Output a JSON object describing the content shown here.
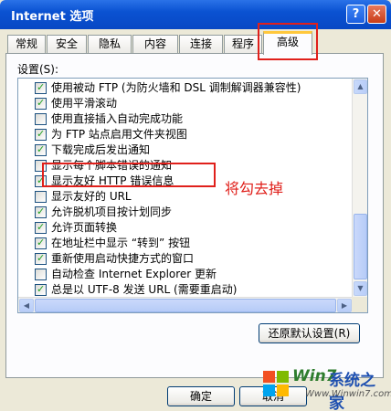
{
  "window": {
    "title": "Internet 选项"
  },
  "titlebar": {
    "help_glyph": "?",
    "close_glyph": "✕"
  },
  "tabs": [
    {
      "label": "常规"
    },
    {
      "label": "安全"
    },
    {
      "label": "隐私"
    },
    {
      "label": "内容"
    },
    {
      "label": "连接"
    },
    {
      "label": "程序"
    },
    {
      "label": "高级",
      "active": true
    }
  ],
  "settings": {
    "label": "设置(S):",
    "items": [
      {
        "label": "使用被动 FTP (为防火墙和 DSL 调制解调器兼容性)",
        "checked": true
      },
      {
        "label": "使用平滑滚动",
        "checked": true
      },
      {
        "label": "使用直接插入自动完成功能",
        "checked": false
      },
      {
        "label": "为 FTP 站点启用文件夹视图",
        "checked": true
      },
      {
        "label": "下载完成后发出通知",
        "checked": true
      },
      {
        "label": "显示每个脚本错误的通知",
        "checked": false
      },
      {
        "label": "显示友好 HTTP 错误信息",
        "checked": true
      },
      {
        "label": "显示友好的 URL",
        "checked": false
      },
      {
        "label": "允许脱机项目按计划同步",
        "checked": true
      },
      {
        "label": "允许页面转换",
        "checked": true
      },
      {
        "label": "在地址栏中显示 “转到” 按钮",
        "checked": true
      },
      {
        "label": "重新使用启动快捷方式的窗口",
        "checked": true
      },
      {
        "label": "自动检查 Internet Explorer 更新",
        "checked": false
      },
      {
        "label": "总是以 UTF-8 发送 URL (需要重启动)",
        "checked": true
      }
    ]
  },
  "annotation": {
    "text": "将勾去掉"
  },
  "buttons": {
    "restore": "还原默认设置(R)",
    "ok": "确定",
    "cancel": "取消"
  },
  "watermark": {
    "brand": "Win7",
    "cn": "系统之家",
    "url": "Www.Winwin7.com"
  },
  "colors": {
    "title_bar": "#0a52d2",
    "annotation_red": "#e0201b",
    "checkbox_check": "#21a121"
  }
}
